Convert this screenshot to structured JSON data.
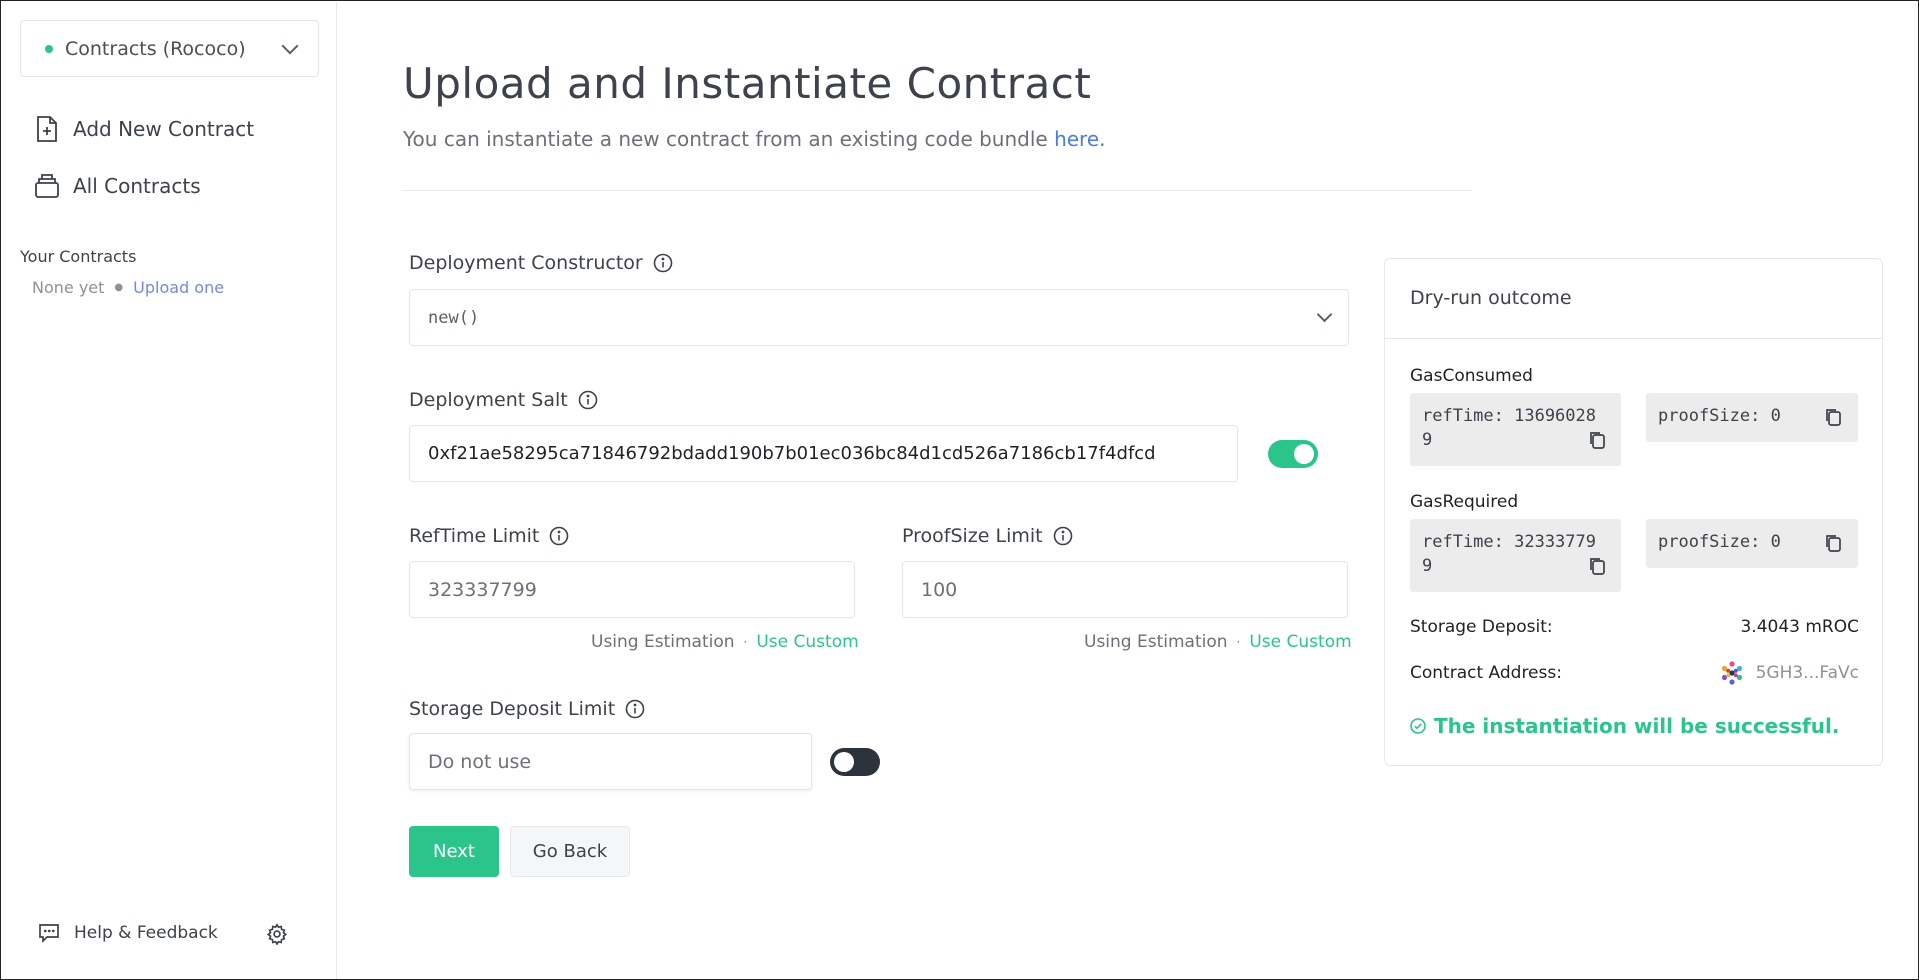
{
  "sidebar": {
    "chain_selector": "Contracts (Rococo)",
    "nav": [
      {
        "label": "Add New Contract",
        "icon": "file-plus-icon"
      },
      {
        "label": "All Contracts",
        "icon": "stack-icon"
      }
    ],
    "your_contracts_heading": "Your Contracts",
    "none_yet": "None yet",
    "upload_one": "Upload one",
    "help_feedback": "Help & Feedback"
  },
  "main": {
    "title": "Upload and Instantiate Contract",
    "subtitle_prefix": "You can instantiate a new contract from an existing code bundle ",
    "subtitle_link": "here",
    "subtitle_suffix": ".",
    "constructor": {
      "label": "Deployment Constructor",
      "value": "new()"
    },
    "salt": {
      "label": "Deployment Salt",
      "value": "0xf21ae58295ca71846792bdadd190b7b01ec036bc84d1cd526a7186cb17f4dfcd",
      "enabled": true
    },
    "reftime": {
      "label": "RefTime Limit",
      "placeholder": "323337799",
      "using": "Using Estimation",
      "custom": "Use Custom"
    },
    "proofsize": {
      "label": "ProofSize Limit",
      "placeholder": "100",
      "using": "Using Estimation",
      "custom": "Use Custom"
    },
    "storage": {
      "label": "Storage Deposit Limit",
      "placeholder": "Do not use",
      "enabled": false
    },
    "next_button": "Next",
    "back_button": "Go Back"
  },
  "dry_run": {
    "title": "Dry-run outcome",
    "gas_consumed_label": "GasConsumed",
    "gas_consumed_ref": "refTime: 136960289",
    "gas_consumed_proof": "proofSize: 0",
    "gas_required_label": "GasRequired",
    "gas_required_ref": "refTime: 323337799",
    "gas_required_proof": "proofSize: 0",
    "storage_deposit_label": "Storage Deposit:",
    "storage_deposit_value": "3.4043 mROC",
    "contract_address_label": "Contract Address:",
    "contract_address_value": "5GH3...FaVc",
    "success_message": "The instantiation will be successful."
  },
  "colors": {
    "accent": "#2bc58b",
    "link": "#4a7be0",
    "toggle_off": "#2d333d"
  }
}
